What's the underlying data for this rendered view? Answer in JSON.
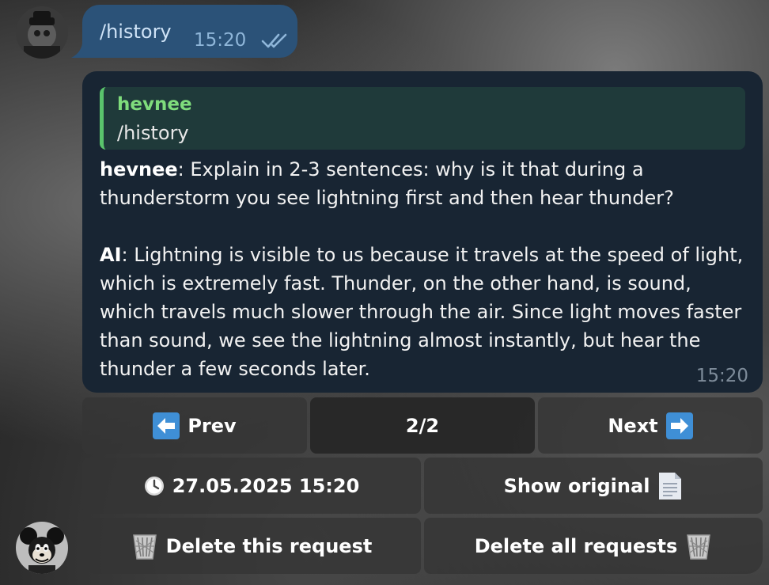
{
  "outgoing": {
    "text": "/history",
    "time": "15:20"
  },
  "incoming": {
    "quote": {
      "author": "hevnee",
      "text": "/history"
    },
    "user_label": "hevnee",
    "user_text": "Explain in 2-3 sentences: why is it that during a thunderstorm you see lightning first and then hear thunder?",
    "ai_label": "AI",
    "ai_text": "Lightning is visible to us because it travels at the speed of light, which is extremely fast. Thunder, on the other hand, is sound, which travels much slower through the air. Since light moves faster than sound, we see the lightning almost instantly, but hear the thunder a few seconds later.",
    "time": "15:20"
  },
  "keyboard": {
    "prev": "Prev",
    "page": "2/2",
    "next": "Next",
    "datetime": "27.05.2025 15:20",
    "show_original": "Show original",
    "delete_this": "Delete this request",
    "delete_all": "Delete all requests"
  },
  "colors": {
    "outgoing_bubble": "#2b5278",
    "incoming_bubble": "#182533",
    "quote_accent": "#5ac46c",
    "quote_author": "#7fdc7c",
    "arrow_icon": "#3f8fd6"
  },
  "icons": {
    "prev": "left-arrow-icon",
    "next": "right-arrow-icon",
    "clock": "clock-icon",
    "document": "document-icon",
    "trash": "wastebasket-icon",
    "read": "double-check-icon"
  }
}
